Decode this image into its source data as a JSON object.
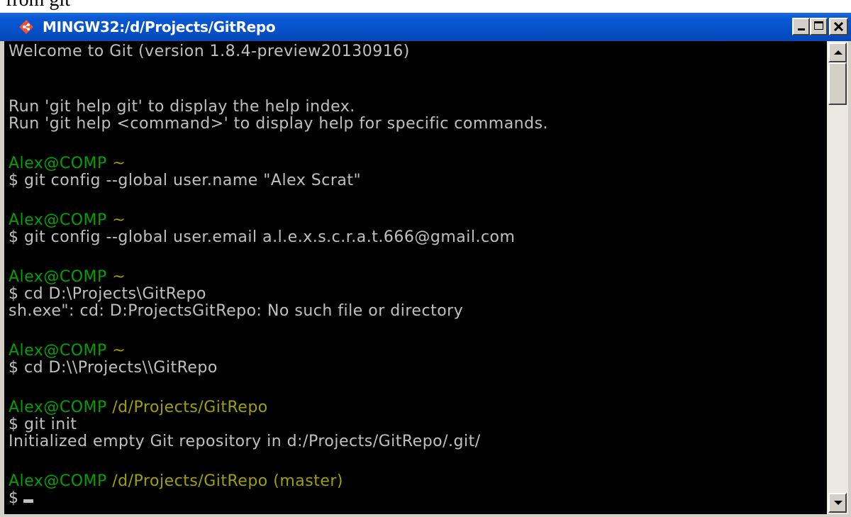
{
  "page_text_above": "from git",
  "window": {
    "title": "MINGW32:/d/Projects/GitRepo",
    "icon": "git-diamond-icon",
    "controls": {
      "minimize": "minimize",
      "maximize": "maximize",
      "close": "close"
    }
  },
  "colors": {
    "titlebar": "#0a58d4",
    "terminal_bg": "#000000",
    "text": "#c0c0c0",
    "prompt_user": "#00a000",
    "prompt_path": "#a0a000"
  },
  "terminal": {
    "lines": [
      "Welcome to Git (version 1.8.4-preview20130916)",
      "Run 'git help git' to display the help index.",
      "Run 'git help <command>' to display help for specific commands.",
      "Alex@COMP",
      "~",
      "$ git config --global user.name \"Alex Scrat\"",
      "Alex@COMP",
      "~",
      "$ git config --global user.email a.l.e.x.s.c.r.a.t.666@gmail.com",
      "Alex@COMP",
      "~",
      "$ cd D:\\Projects\\GitRepo",
      "sh.exe\": cd: D:ProjectsGitRepo: No such file or directory",
      "Alex@COMP",
      "~",
      "$ cd D:\\\\Projects\\\\GitRepo",
      "Alex@COMP",
      "/d/Projects/GitRepo",
      "$ git init",
      "Initialized empty Git repository in d:/Projects/GitRepo/.git/",
      "Alex@COMP",
      "/d/Projects/GitRepo (master)",
      "$"
    ]
  }
}
